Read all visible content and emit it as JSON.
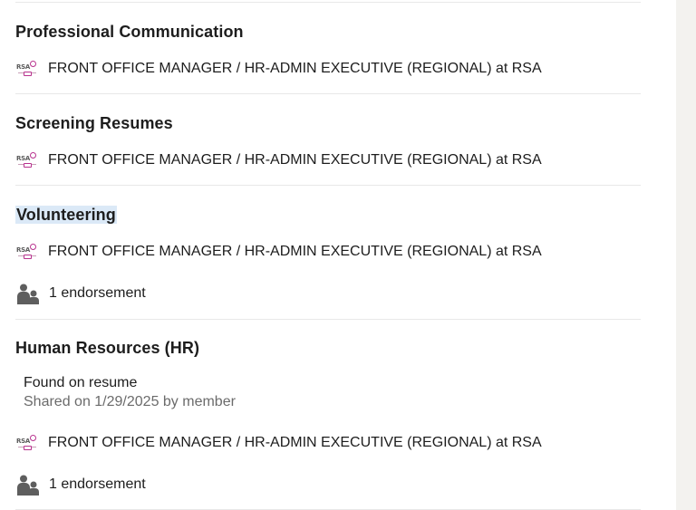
{
  "skills": [
    {
      "title": "Professional Communication",
      "association": "FRONT OFFICE MANAGER / HR-ADMIN EXECUTIVE (REGIONAL) at RSA"
    },
    {
      "title": "Screening Resumes",
      "association": "FRONT OFFICE MANAGER / HR-ADMIN EXECUTIVE (REGIONAL) at RSA"
    },
    {
      "title": "Volunteering",
      "association": "FRONT OFFICE MANAGER / HR-ADMIN EXECUTIVE (REGIONAL) at RSA",
      "endorsements": "1 endorsement"
    },
    {
      "title": "Human Resources (HR)",
      "found_title": "Found on resume",
      "found_sub": "Shared on 1/29/2025 by member",
      "association": "FRONT OFFICE MANAGER / HR-ADMIN EXECUTIVE (REGIONAL) at RSA",
      "endorsements": "1 endorsement"
    }
  ],
  "company_logo": {
    "text": "RSA",
    "accent": "#b8328e"
  },
  "icons": {
    "endorsement": "people-icon",
    "company": "rsa-company-logo"
  },
  "colors": {
    "text": "#1d1d1d",
    "muted": "#6b6b6b",
    "divider": "#e8e8e8",
    "highlight": "#dbe9f7",
    "rail": "#f3f2ef"
  }
}
